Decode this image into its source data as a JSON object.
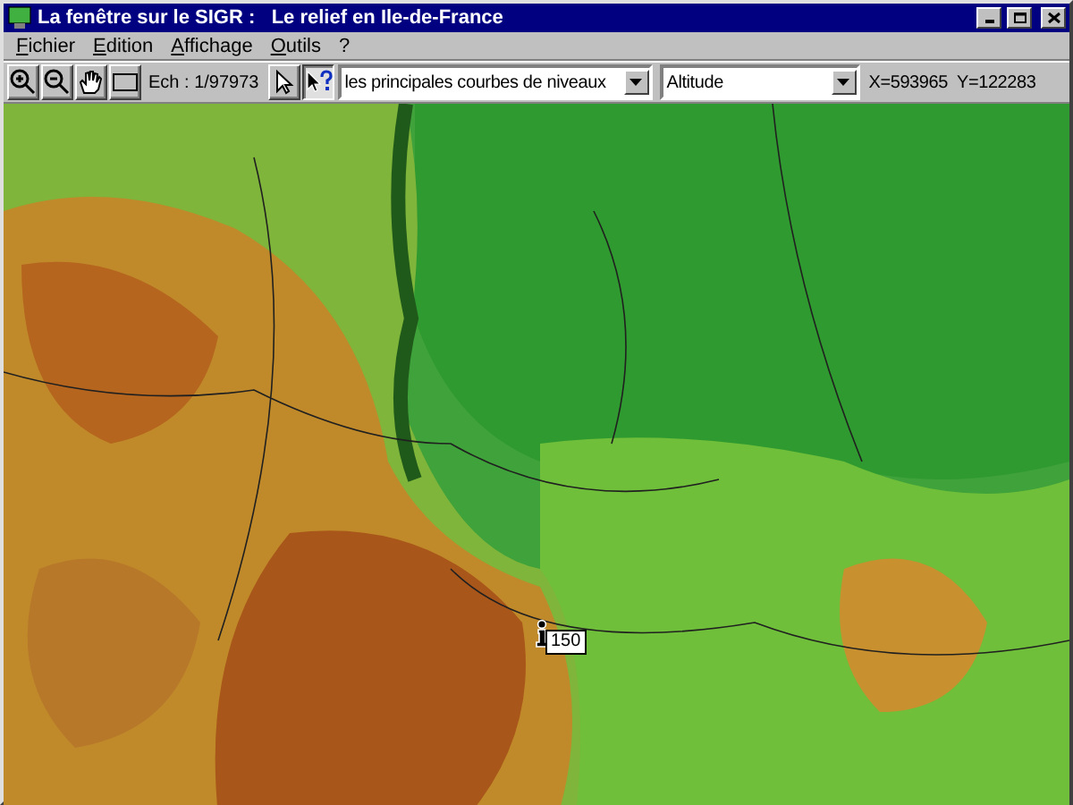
{
  "window": {
    "title": "La fenêtre sur le SIGR :   Le relief en Ile-de-France"
  },
  "menu": [
    "Fichier",
    "Edition",
    "Affichage",
    "Outils",
    "?"
  ],
  "toolbar": {
    "zoom_tools": [
      {
        "kind": "zoom-in",
        "selected": false
      },
      {
        "kind": "zoom-out",
        "selected": false
      },
      {
        "kind": "pan",
        "selected": false
      },
      {
        "kind": "extent",
        "selected": false
      }
    ],
    "scale": "Ech : 1/97973",
    "pointer_tools": [
      {
        "kind": "select",
        "selected": false
      },
      {
        "kind": "query",
        "selected": true
      }
    ],
    "layer_select": {
      "value": "les principales courbes de niveaux"
    },
    "theme_select": {
      "value": "Altitude"
    },
    "coordinates": "X=593965  Y=122283"
  },
  "map": {
    "tooltip": "150"
  }
}
